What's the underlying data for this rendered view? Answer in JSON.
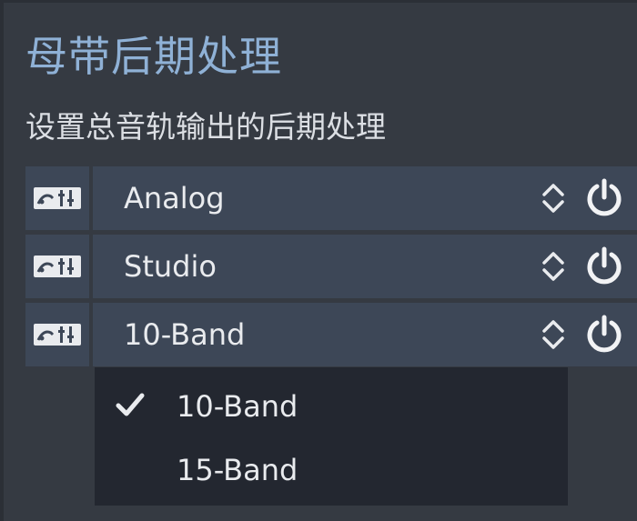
{
  "panel": {
    "title": "母带后期处理",
    "subtitle": "设置总音轨输出的后期处理"
  },
  "rows": [
    {
      "preset": "Analog",
      "tool_icon": "eq-settings-icon",
      "power_icon": "power-icon"
    },
    {
      "preset": "Studio",
      "tool_icon": "eq-settings-icon",
      "power_icon": "power-icon"
    },
    {
      "preset": "10-Band",
      "tool_icon": "eq-settings-icon",
      "power_icon": "power-icon"
    }
  ],
  "dropdown": {
    "options": [
      {
        "label": "10-Band",
        "selected": true
      },
      {
        "label": "15-Band",
        "selected": false
      }
    ]
  },
  "colors": {
    "background": "#353a42",
    "control_bg": "#3d4757",
    "dropdown_bg": "#232730",
    "title": "#8fb1d6",
    "text": "#e9ebee"
  }
}
